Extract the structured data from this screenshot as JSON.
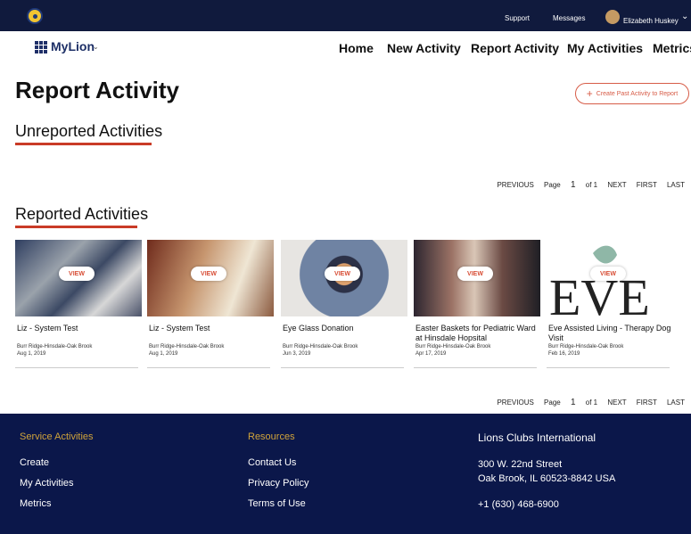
{
  "topbar": {
    "support": "Support",
    "messages": "Messages",
    "user": "Elizabeth Huskey"
  },
  "brand": {
    "name": "MyLion",
    "caret": "⌄"
  },
  "nav": {
    "home": "Home",
    "new_activity": "New Activity",
    "report_activity": "Report Activity",
    "my_activities": "My Activities",
    "metrics": "Metrics"
  },
  "page": {
    "title": "Report Activity",
    "create_past": "Create Past Activity to Report"
  },
  "sections": {
    "unreported": "Unreported Activities",
    "reported": "Reported Activities"
  },
  "pager": {
    "previous": "PREVIOUS",
    "page": "Page",
    "current": "1",
    "of": "of 1",
    "next": "NEXT",
    "first": "FIRST",
    "last": "LAST"
  },
  "cards": [
    {
      "title": "Liz - System Test",
      "location": "Burr Ridge-Hinsdale-Oak Brook",
      "date": "Aug 1, 2019",
      "view": "VIEW"
    },
    {
      "title": "Liz - System Test",
      "location": "Burr Ridge-Hinsdale-Oak Brook",
      "date": "Aug 1, 2019",
      "view": "VIEW"
    },
    {
      "title": "Eye Glass Donation",
      "location": "Burr Ridge-Hinsdale-Oak Brook",
      "date": "Jun 3, 2019",
      "view": "VIEW"
    },
    {
      "title": "Easter Baskets for Pediatric Ward at Hinsdale Hopsital",
      "location": "Burr Ridge-Hinsdale-Oak Brook",
      "date": "Apr 17, 2019",
      "view": "VIEW"
    },
    {
      "title": "Eve Assisted Living - Therapy Dog Visit",
      "location": "Burr Ridge-Hinsdale-Oak Brook",
      "date": "Feb 16, 2019",
      "view": "VIEW"
    }
  ],
  "footer": {
    "service_heading": "Service Activities",
    "service_links": [
      "Create",
      "My Activities",
      "Metrics"
    ],
    "resources_heading": "Resources",
    "resource_links": [
      "Contact Us",
      "Privacy Policy",
      "Terms of Use"
    ],
    "org_heading": "Lions Clubs International",
    "address1": "300 W. 22nd Street",
    "address2": "Oak Brook, IL 60523-8842 USA",
    "phone": "+1 (630) 468-6900"
  },
  "colors": {
    "accent": "#c93b27",
    "navy": "#101a3d",
    "footer": "#0b174a",
    "gold": "#d0a33a"
  }
}
